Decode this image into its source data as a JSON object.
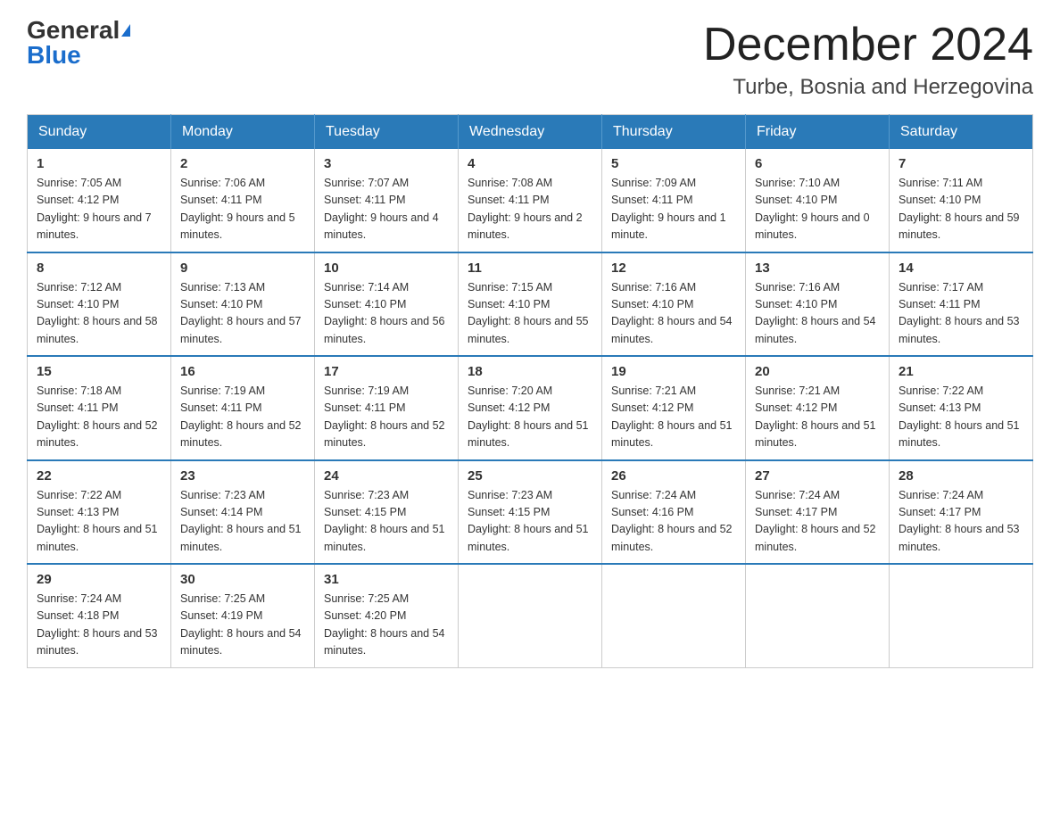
{
  "logo": {
    "general": "General",
    "blue": "Blue"
  },
  "header": {
    "month": "December 2024",
    "location": "Turbe, Bosnia and Herzegovina"
  },
  "days_of_week": [
    "Sunday",
    "Monday",
    "Tuesday",
    "Wednesday",
    "Thursday",
    "Friday",
    "Saturday"
  ],
  "weeks": [
    [
      {
        "day": "1",
        "sunrise": "7:05 AM",
        "sunset": "4:12 PM",
        "daylight": "9 hours and 7 minutes."
      },
      {
        "day": "2",
        "sunrise": "7:06 AM",
        "sunset": "4:11 PM",
        "daylight": "9 hours and 5 minutes."
      },
      {
        "day": "3",
        "sunrise": "7:07 AM",
        "sunset": "4:11 PM",
        "daylight": "9 hours and 4 minutes."
      },
      {
        "day": "4",
        "sunrise": "7:08 AM",
        "sunset": "4:11 PM",
        "daylight": "9 hours and 2 minutes."
      },
      {
        "day": "5",
        "sunrise": "7:09 AM",
        "sunset": "4:11 PM",
        "daylight": "9 hours and 1 minute."
      },
      {
        "day": "6",
        "sunrise": "7:10 AM",
        "sunset": "4:10 PM",
        "daylight": "9 hours and 0 minutes."
      },
      {
        "day": "7",
        "sunrise": "7:11 AM",
        "sunset": "4:10 PM",
        "daylight": "8 hours and 59 minutes."
      }
    ],
    [
      {
        "day": "8",
        "sunrise": "7:12 AM",
        "sunset": "4:10 PM",
        "daylight": "8 hours and 58 minutes."
      },
      {
        "day": "9",
        "sunrise": "7:13 AM",
        "sunset": "4:10 PM",
        "daylight": "8 hours and 57 minutes."
      },
      {
        "day": "10",
        "sunrise": "7:14 AM",
        "sunset": "4:10 PM",
        "daylight": "8 hours and 56 minutes."
      },
      {
        "day": "11",
        "sunrise": "7:15 AM",
        "sunset": "4:10 PM",
        "daylight": "8 hours and 55 minutes."
      },
      {
        "day": "12",
        "sunrise": "7:16 AM",
        "sunset": "4:10 PM",
        "daylight": "8 hours and 54 minutes."
      },
      {
        "day": "13",
        "sunrise": "7:16 AM",
        "sunset": "4:10 PM",
        "daylight": "8 hours and 54 minutes."
      },
      {
        "day": "14",
        "sunrise": "7:17 AM",
        "sunset": "4:11 PM",
        "daylight": "8 hours and 53 minutes."
      }
    ],
    [
      {
        "day": "15",
        "sunrise": "7:18 AM",
        "sunset": "4:11 PM",
        "daylight": "8 hours and 52 minutes."
      },
      {
        "day": "16",
        "sunrise": "7:19 AM",
        "sunset": "4:11 PM",
        "daylight": "8 hours and 52 minutes."
      },
      {
        "day": "17",
        "sunrise": "7:19 AM",
        "sunset": "4:11 PM",
        "daylight": "8 hours and 52 minutes."
      },
      {
        "day": "18",
        "sunrise": "7:20 AM",
        "sunset": "4:12 PM",
        "daylight": "8 hours and 51 minutes."
      },
      {
        "day": "19",
        "sunrise": "7:21 AM",
        "sunset": "4:12 PM",
        "daylight": "8 hours and 51 minutes."
      },
      {
        "day": "20",
        "sunrise": "7:21 AM",
        "sunset": "4:12 PM",
        "daylight": "8 hours and 51 minutes."
      },
      {
        "day": "21",
        "sunrise": "7:22 AM",
        "sunset": "4:13 PM",
        "daylight": "8 hours and 51 minutes."
      }
    ],
    [
      {
        "day": "22",
        "sunrise": "7:22 AM",
        "sunset": "4:13 PM",
        "daylight": "8 hours and 51 minutes."
      },
      {
        "day": "23",
        "sunrise": "7:23 AM",
        "sunset": "4:14 PM",
        "daylight": "8 hours and 51 minutes."
      },
      {
        "day": "24",
        "sunrise": "7:23 AM",
        "sunset": "4:15 PM",
        "daylight": "8 hours and 51 minutes."
      },
      {
        "day": "25",
        "sunrise": "7:23 AM",
        "sunset": "4:15 PM",
        "daylight": "8 hours and 51 minutes."
      },
      {
        "day": "26",
        "sunrise": "7:24 AM",
        "sunset": "4:16 PM",
        "daylight": "8 hours and 52 minutes."
      },
      {
        "day": "27",
        "sunrise": "7:24 AM",
        "sunset": "4:17 PM",
        "daylight": "8 hours and 52 minutes."
      },
      {
        "day": "28",
        "sunrise": "7:24 AM",
        "sunset": "4:17 PM",
        "daylight": "8 hours and 53 minutes."
      }
    ],
    [
      {
        "day": "29",
        "sunrise": "7:24 AM",
        "sunset": "4:18 PM",
        "daylight": "8 hours and 53 minutes."
      },
      {
        "day": "30",
        "sunrise": "7:25 AM",
        "sunset": "4:19 PM",
        "daylight": "8 hours and 54 minutes."
      },
      {
        "day": "31",
        "sunrise": "7:25 AM",
        "sunset": "4:20 PM",
        "daylight": "8 hours and 54 minutes."
      },
      null,
      null,
      null,
      null
    ]
  ]
}
